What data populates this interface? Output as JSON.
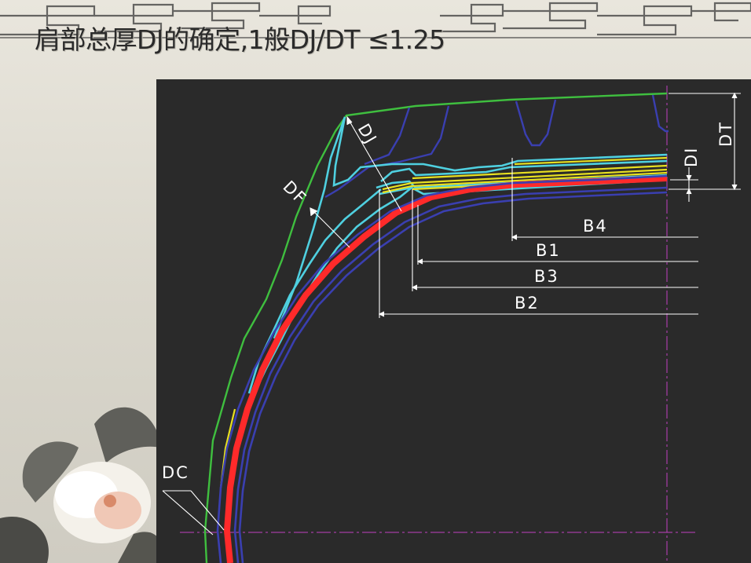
{
  "slide": {
    "title": "肩部总厚DJ的确定,1般DJ/DT ≤1.25"
  },
  "diagram": {
    "labels": {
      "dj": "DJ",
      "df": "DF",
      "dt": "DT",
      "di": "DI",
      "dc": "DC",
      "b1": "B1",
      "b2": "B2",
      "b3": "B3",
      "b4": "B4"
    },
    "colors": {
      "background": "#2a2a2a",
      "outer_profile": "#3fbf3f",
      "belt_edge": "#4fd0e0",
      "belt_plies": "#e8e020",
      "carcass": "#ff2a2a",
      "inner_liner": "#3a3fb0",
      "dimension_lines": "#ffffff",
      "centerline": "#c040c0"
    }
  }
}
